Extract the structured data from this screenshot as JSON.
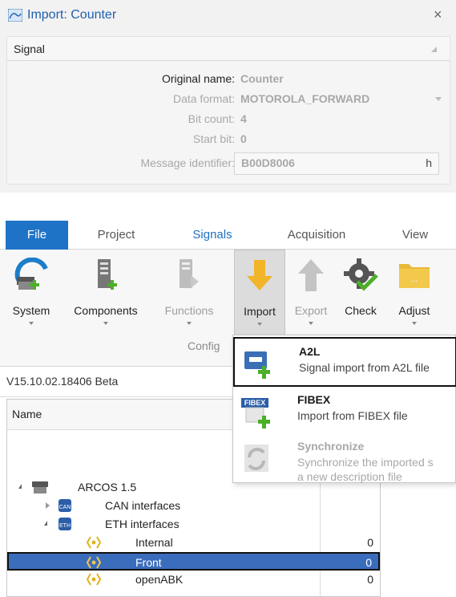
{
  "dialog": {
    "title": "Import: Counter",
    "close": "×",
    "group": "Signal",
    "fields": [
      {
        "label": "Original name:",
        "value": "Counter"
      },
      {
        "label": "Data format:",
        "value": "MOTOROLA_FORWARD"
      },
      {
        "label": "Bit count:",
        "value": "4"
      },
      {
        "label": "Start bit:",
        "value": "0"
      },
      {
        "label": "Message identifier:",
        "value": "B00D8006",
        "suffix": "h"
      }
    ]
  },
  "menu_tabs": [
    "File",
    "Project",
    "Signals",
    "Acquisition",
    "View"
  ],
  "ribbon": {
    "buttons": [
      {
        "label": "System",
        "icon": "system-icon"
      },
      {
        "label": "Components",
        "icon": "components-icon"
      },
      {
        "label": "Functions",
        "icon": "functions-icon"
      },
      {
        "label": "Import",
        "icon": "import-arrow-icon"
      },
      {
        "label": "Export",
        "icon": "export-arrow-icon"
      },
      {
        "label": "Check",
        "icon": "check-gear-icon"
      },
      {
        "label": "Adjust",
        "icon": "folder-icon"
      }
    ],
    "group_caption": "Config"
  },
  "version": "V15.10.02.18406 Beta",
  "tree": {
    "column_name": "Name",
    "rows": [
      {
        "name": "ARCOS 1.5",
        "value": ""
      },
      {
        "name": "CAN interfaces",
        "value": ""
      },
      {
        "name": "ETH interfaces",
        "value": ""
      },
      {
        "name": "Internal",
        "value": "0"
      },
      {
        "name": "Front",
        "value": "0"
      },
      {
        "name": "openABK",
        "value": "0"
      }
    ]
  },
  "import_menu": {
    "items": [
      {
        "title": "A2L",
        "desc": "Signal import from A2L file"
      },
      {
        "title": "FIBEX",
        "desc": "Import from FIBEX file",
        "badge": "FIBEX"
      },
      {
        "title": "Synchronize",
        "desc": "Synchronize the imported s",
        "desc2": "a new description file"
      }
    ]
  },
  "colors": {
    "accent": "#1f73c7",
    "selection": "#3b6dbd",
    "import_arrow": "#f2b428",
    "check_green": "#4caf2a"
  }
}
